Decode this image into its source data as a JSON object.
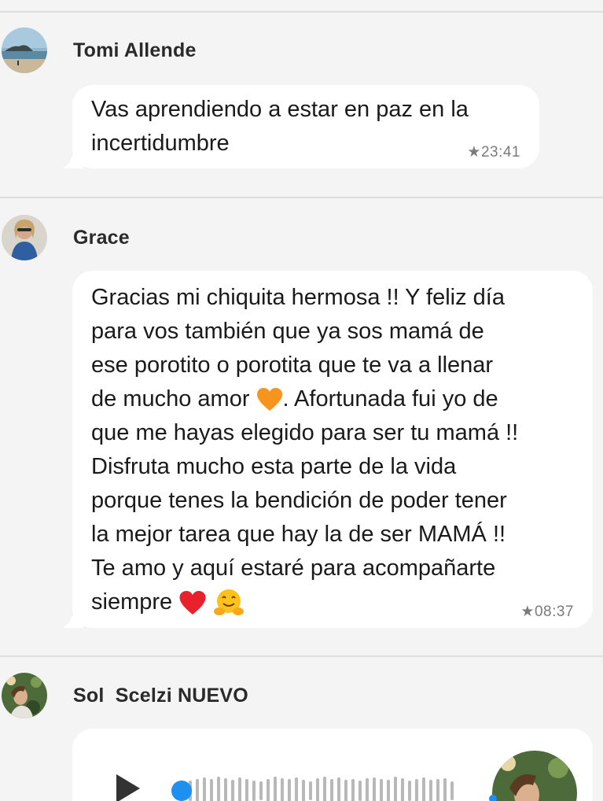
{
  "messages": [
    {
      "sender": "Tomi Allende",
      "avatar_icon": "beach-island-photo",
      "text": "Vas aprendiendo a estar en paz en la\nincertidumbre",
      "starred": true,
      "time": "23:41"
    },
    {
      "sender": "Grace",
      "avatar_icon": "woman-portrait-photo",
      "text_lines": [
        "Gracias mi chiquita hermosa !! Y feliz día",
        "para vos también que ya sos mamá de",
        "ese porotito o porotita que te va a llenar",
        "de mucho amor ",
        ". Afortunada fui yo de",
        "que me hayas elegido para ser tu mamá !!",
        "Disfruta mucho esta parte de la vida",
        "porque tenes la bendición de poder tener",
        "la mejor tarea que hay la de ser MAMÁ !!",
        "Te amo y aquí estaré para acompañarte",
        "siempre "
      ],
      "emojis": [
        "orange-heart",
        "red-heart",
        "hugging-face"
      ],
      "starred": true,
      "time": "08:37"
    },
    {
      "sender": "Sol  Scelzi NUEVO",
      "avatar_icon": "woman-flowers-photo",
      "type": "voice-note",
      "play_icon": "play-icon"
    }
  ],
  "colors": {
    "background": "#f4f4f4",
    "bubble": "#ffffff",
    "scrubber": "#1e90f0",
    "timestamp": "#7b7b7b"
  }
}
